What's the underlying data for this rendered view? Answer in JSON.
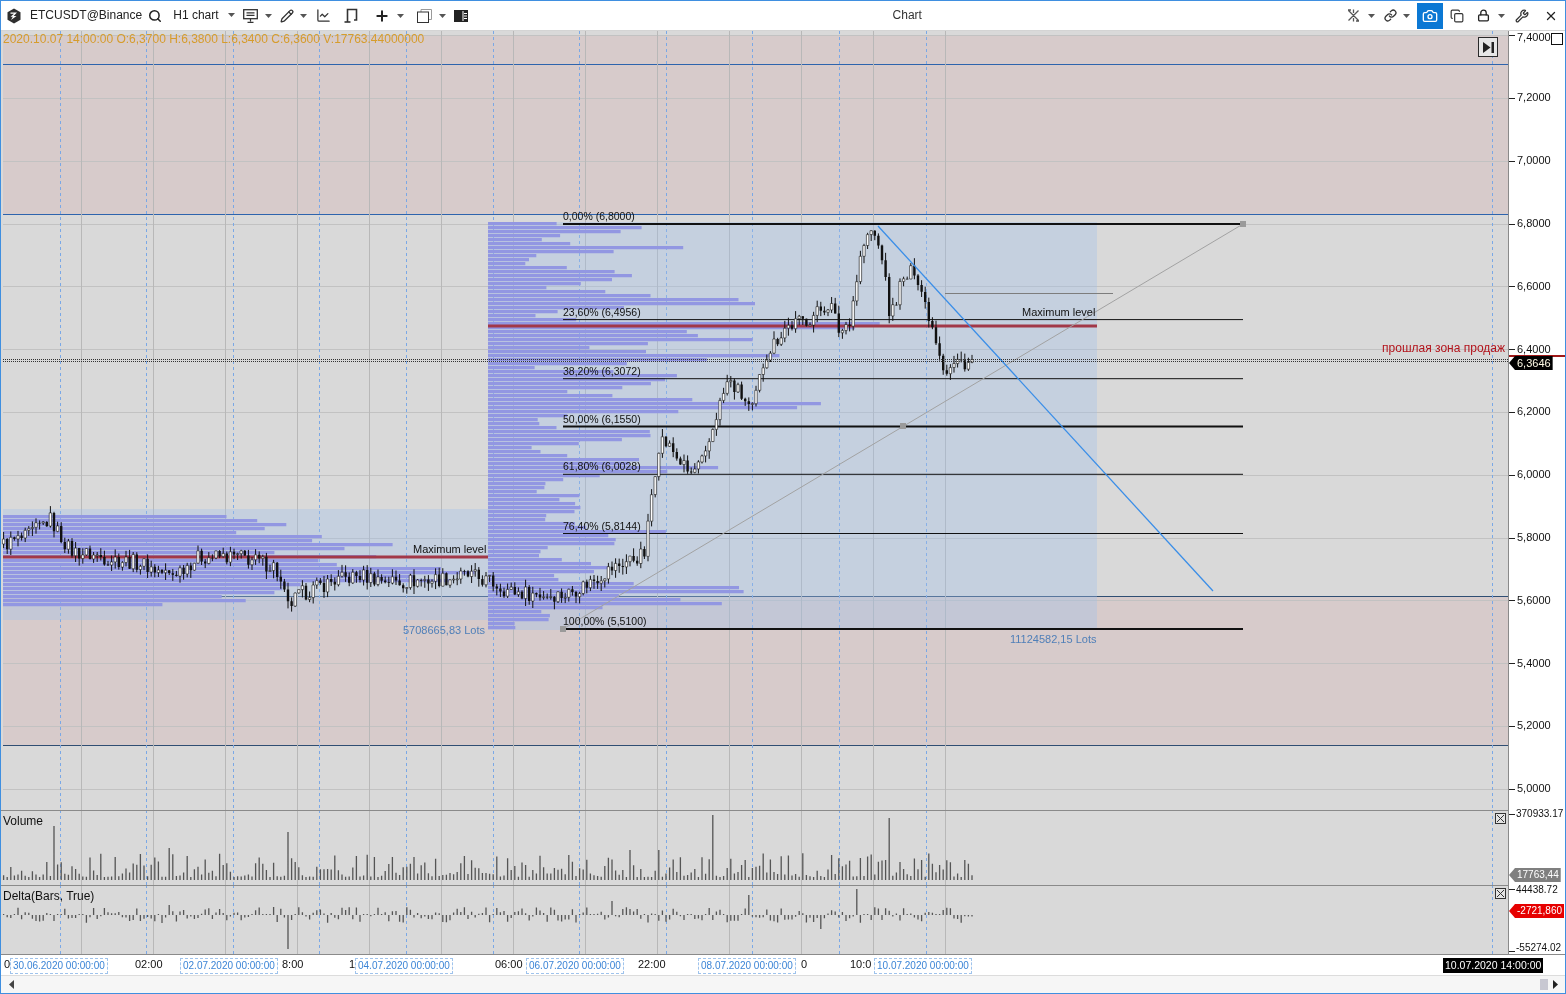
{
  "toolbar": {
    "symbol": "ETCUSDT@Binance",
    "timeframe": "H1 chart",
    "title": "Chart",
    "snapshot_button": {
      "selected": true
    }
  },
  "info_line": "2020.10.07 14:00:00 O:6,3700 H:6,3800 L:6,3400 C:6,3600 V:17763.44000000",
  "price_pane": {
    "zone_note": "прошлая зона продаж",
    "fibonacci_levels": [
      {
        "label": "0,00% (6,8000)",
        "kind": "major"
      },
      {
        "label": "23,60% (6,4956)",
        "kind": "minor"
      },
      {
        "label": "38,20% (6,3072)",
        "kind": "minor"
      },
      {
        "label": "50,00% (6,1550)",
        "kind": "major"
      },
      {
        "label": "61,80% (6,0028)",
        "kind": "minor"
      },
      {
        "label": "76,40% (5,8144)",
        "kind": "minor"
      },
      {
        "label": "100,00% (5,5100)",
        "kind": "major"
      }
    ],
    "volume_profiles": [
      {
        "max_label": "Maximum level",
        "total": "5708665,83 Lots"
      },
      {
        "max_label": "Maximum level",
        "total": "11124582,15 Lots"
      }
    ]
  },
  "price_axis": {
    "ticks": [
      "7,4000",
      "7,2000",
      "7,0000",
      "6,8000",
      "6,6000",
      "6,4000",
      "6,2000",
      "6,0000",
      "5,8000",
      "5,6000",
      "5,4000",
      "5,2000",
      "5,0000"
    ],
    "last_price": "6,3646"
  },
  "volume_pane": {
    "title": "Volume",
    "axis_max": "370933.17",
    "last_value": "17763,44"
  },
  "delta_pane": {
    "title": "Delta(Bars, True)",
    "axis_max": "44438.72",
    "axis_min": "-55274.02",
    "last_value": "-2721,860"
  },
  "time_axis": {
    "labels": [
      {
        "text": "0",
        "kind": "time"
      },
      {
        "text": "30.06.2020 00:00:00",
        "kind": "date"
      },
      {
        "text": "02:00",
        "kind": "time"
      },
      {
        "text": "02.07.2020 00:00:00",
        "kind": "date"
      },
      {
        "text": "8:00",
        "kind": "time"
      },
      {
        "text": "1",
        "kind": "time"
      },
      {
        "text": "04.07.2020 00:00:00",
        "kind": "date"
      },
      {
        "text": "06:00",
        "kind": "time"
      },
      {
        "text": "06.07.2020 00:00:00",
        "kind": "date"
      },
      {
        "text": "22:00",
        "kind": "time"
      },
      {
        "text": "08.07.2020 00:00:00",
        "kind": "date"
      },
      {
        "text": "0",
        "kind": "time"
      },
      {
        "text": "10:0",
        "kind": "time"
      },
      {
        "text": "10.07.2020 00:00:00",
        "kind": "date"
      }
    ],
    "cursor_label": "10.07.2020 14:00:00"
  }
}
